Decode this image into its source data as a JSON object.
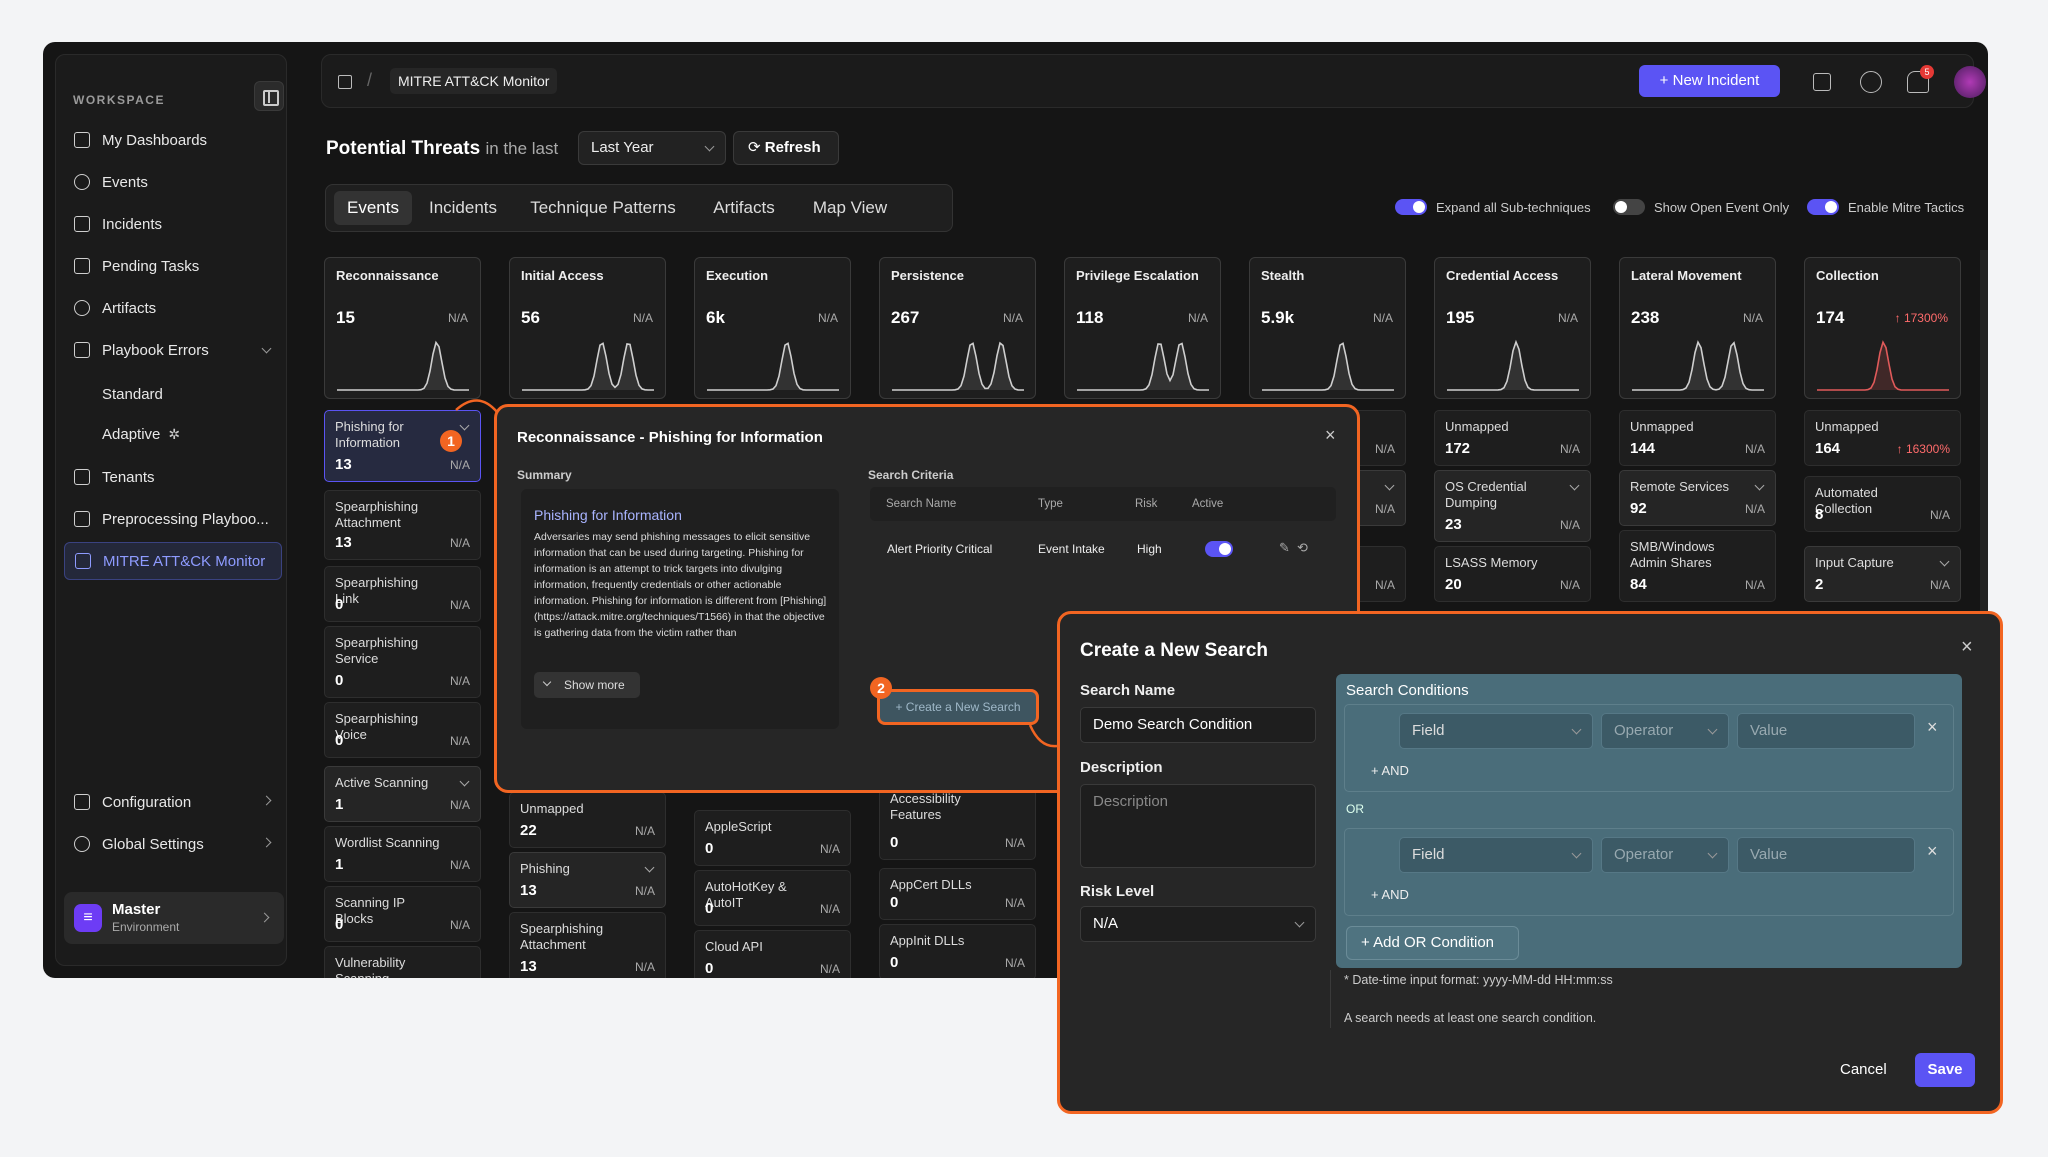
{
  "sidebar": {
    "workspace_label": "WORKSPACE",
    "items": [
      "My Dashboards",
      "Events",
      "Incidents",
      "Pending Tasks",
      "Artifacts",
      "Playbook Errors",
      "Standard",
      "Adaptive",
      "Tenants",
      "Preprocessing Playboo...",
      "MITRE ATT&CK Monitor"
    ],
    "bottom_items": [
      "Configuration",
      "Global Settings"
    ],
    "env_name": "Master",
    "env_label": "Environment",
    "env_icon_letter": "≡"
  },
  "header": {
    "breadcrumb": "MITRE ATT&CK Monitor",
    "new_incident": "New Incident",
    "notif_count": "5"
  },
  "page": {
    "title": "Potential Threats",
    "title_suffix": "in the last",
    "range": "Last Year",
    "refresh": "Refresh"
  },
  "tabs": [
    "Events",
    "Incidents",
    "Technique Patterns",
    "Artifacts",
    "Map View"
  ],
  "toggles": [
    {
      "label": "Expand all Sub-techniques",
      "on": true
    },
    {
      "label": "Show Open Event Only",
      "on": false
    },
    {
      "label": "Enable Mitre Tactics",
      "on": true
    }
  ],
  "tactics": [
    {
      "name": "Reconnaissance",
      "value": "15",
      "pct": "N/A"
    },
    {
      "name": "Initial Access",
      "value": "56",
      "pct": "N/A"
    },
    {
      "name": "Execution",
      "value": "6k",
      "pct": "N/A"
    },
    {
      "name": "Persistence",
      "value": "267",
      "pct": "N/A"
    },
    {
      "name": "Privilege Escalation",
      "value": "118",
      "pct": "N/A"
    },
    {
      "name": "Stealth",
      "value": "5.9k",
      "pct": "N/A"
    },
    {
      "name": "Credential Access",
      "value": "195",
      "pct": "N/A"
    },
    {
      "name": "Lateral Movement",
      "value": "238",
      "pct": "N/A"
    },
    {
      "name": "Collection",
      "value": "174",
      "pct": "↑ 17300%"
    }
  ],
  "techniques": {
    "recon": [
      {
        "name": "Phishing for Information",
        "value": "13",
        "pct": "N/A"
      },
      {
        "name": "Spearphishing Attachment",
        "value": "13",
        "pct": "N/A"
      },
      {
        "name": "Spearphishing Link",
        "value": "0",
        "pct": "N/A"
      },
      {
        "name": "Spearphishing Service",
        "value": "0",
        "pct": "N/A"
      },
      {
        "name": "Spearphishing Voice",
        "value": "0",
        "pct": "N/A"
      },
      {
        "name": "Active Scanning",
        "value": "1",
        "pct": "N/A"
      },
      {
        "name": "Wordlist Scanning",
        "value": "1",
        "pct": "N/A"
      },
      {
        "name": "Scanning IP Blocks",
        "value": "0",
        "pct": "N/A"
      },
      {
        "name": "Vulnerability Scanning",
        "value": "",
        "pct": ""
      }
    ],
    "initial": [
      {
        "name": "Unmapped",
        "value": "22",
        "pct": "N/A"
      },
      {
        "name": "Phishing",
        "value": "13",
        "pct": "N/A"
      },
      {
        "name": "Spearphishing Attachment",
        "value": "13",
        "pct": "N/A"
      }
    ],
    "execution": [
      {
        "name": "AppleScript",
        "value": "0",
        "pct": "N/A"
      },
      {
        "name": "AutoHotKey & AutoIT",
        "value": "0",
        "pct": "N/A"
      },
      {
        "name": "Cloud API",
        "value": "0",
        "pct": "N/A"
      }
    ],
    "persistence": [
      {
        "name": "Accessibility Features",
        "value": "0",
        "pct": "N/A"
      },
      {
        "name": "AppCert DLLs",
        "value": "0",
        "pct": "N/A"
      },
      {
        "name": "AppInit DLLs",
        "value": "0",
        "pct": "N/A"
      }
    ],
    "stealth_pct": [
      "N/A",
      "N/A",
      "N/A"
    ],
    "credential": [
      {
        "name": "Unmapped",
        "value": "172",
        "pct": "N/A"
      },
      {
        "name": "OS Credential Dumping",
        "value": "23",
        "pct": "N/A"
      },
      {
        "name": "LSASS Memory",
        "value": "20",
        "pct": "N/A"
      }
    ],
    "lateral": [
      {
        "name": "Unmapped",
        "value": "144",
        "pct": "N/A"
      },
      {
        "name": "Remote Services",
        "value": "92",
        "pct": "N/A"
      },
      {
        "name": "SMB/Windows Admin Shares",
        "value": "84",
        "pct": "N/A"
      }
    ],
    "collection": [
      {
        "name": "Unmapped",
        "value": "164",
        "pct": "↑ 16300%"
      },
      {
        "name": "Automated Collection",
        "value": "8",
        "pct": "N/A"
      },
      {
        "name": "Input Capture",
        "value": "2",
        "pct": "N/A"
      }
    ]
  },
  "popup1": {
    "title": "Reconnaissance - Phishing for Information",
    "summary_label": "Summary",
    "summary_title": "Phishing for Information",
    "summary_text": "Adversaries may send phishing messages to elicit sensitive information that can be used during targeting. Phishing for information is an attempt to trick targets into divulging information, frequently credentials or other actionable information. Phishing for information is different from [Phishing](https://attack.mitre.org/techniques/T1566) in that the objective is gathering data from the victim rather than",
    "show_more": "Show more",
    "criteria_label": "Search Criteria",
    "columns": [
      "Search Name",
      "Type",
      "Risk",
      "Active"
    ],
    "row": {
      "name": "Alert Priority Critical",
      "type": "Event Intake",
      "risk": "High"
    },
    "create_btn": "+ Create a New Search",
    "badge1": "1",
    "badge2": "2"
  },
  "popup2": {
    "title": "Create a New Search",
    "name_label": "Search Name",
    "name_value": "Demo Search Condition",
    "desc_label": "Description",
    "desc_placeholder": "Description",
    "risk_label": "Risk Level",
    "risk_value": "N/A",
    "conditions_label": "Search Conditions",
    "field_placeholder": "Field",
    "operator_placeholder": "Operator",
    "value_placeholder": "Value",
    "and_label": "AND",
    "or_label": "OR",
    "add_or": "Add OR Condition",
    "note1": "* Date-time input format: yyyy-MM-dd HH:mm:ss",
    "note2": "A search needs at least one search condition.",
    "cancel": "Cancel",
    "save": "Save"
  }
}
